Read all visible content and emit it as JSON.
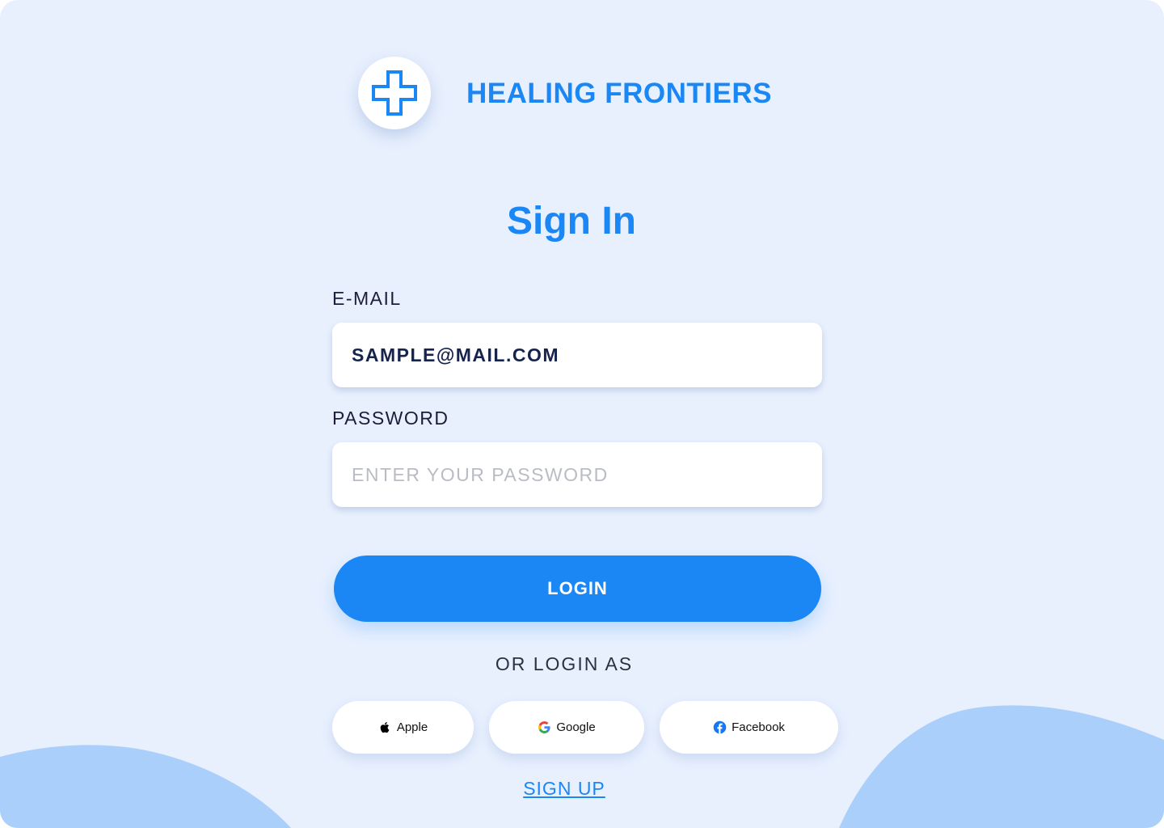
{
  "brand": {
    "name": "HEALING FRONTIERS",
    "logo_icon": "medical-cross-icon",
    "color": "#1a87f5"
  },
  "form": {
    "title": "Sign In",
    "email": {
      "label": "E-MAIL",
      "value": "SAMPLE@MAIL.COM"
    },
    "password": {
      "label": "PASSWORD",
      "placeholder": "ENTER YOUR PASSWORD",
      "value": ""
    },
    "login_button": "LOGIN",
    "alt_login_text": "OR LOGIN AS",
    "social": [
      {
        "label": "Apple",
        "icon": "apple-icon"
      },
      {
        "label": "Google",
        "icon": "google-icon"
      },
      {
        "label": "Facebook",
        "icon": "facebook-icon"
      }
    ],
    "signup_link": "SIGN UP"
  },
  "colors": {
    "background": "#e8f0fe",
    "accent": "#1a87f5",
    "blob": "#abcffb"
  }
}
